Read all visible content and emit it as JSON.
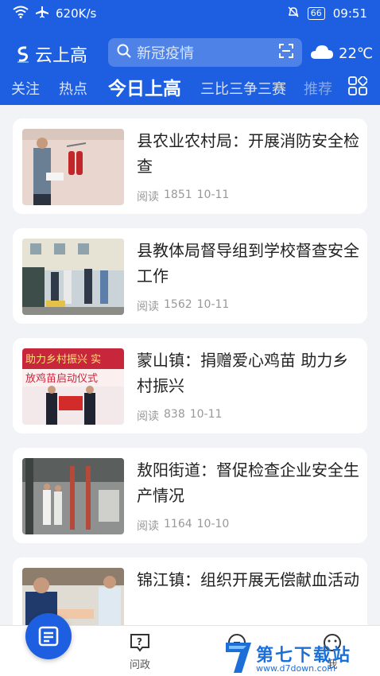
{
  "status_bar": {
    "network_speed": "620K/s",
    "battery": "66",
    "time": "09:51"
  },
  "header": {
    "app_name": "云上高",
    "search_placeholder": "新冠疫情",
    "temperature": "22℃",
    "accent_color": "#1d5fe0"
  },
  "tabs": [
    {
      "label": "关注"
    },
    {
      "label": "热点"
    },
    {
      "label": "今日上高",
      "active": true
    },
    {
      "label": "三比三争三赛"
    },
    {
      "label": "推荐"
    }
  ],
  "articles": [
    {
      "title": "县农业农村局：开展消防安全检查",
      "read_label": "阅读",
      "reads": "1851",
      "date": "10-11"
    },
    {
      "title": "县教体局督导组到学校督查安全工作",
      "read_label": "阅读",
      "reads": "1562",
      "date": "10-11"
    },
    {
      "title": "蒙山镇：捐赠爱心鸡苗 助力乡村振兴",
      "read_label": "阅读",
      "reads": "838",
      "date": "10-11"
    },
    {
      "title": "敖阳街道：督促检查企业安全生产情况",
      "read_label": "阅读",
      "reads": "1164",
      "date": "10-10"
    },
    {
      "title": "锦江镇：组织开展无偿献血活动",
      "read_label": "",
      "reads": "",
      "date": ""
    }
  ],
  "bottom_nav": [
    {
      "label": "",
      "icon": "news-icon"
    },
    {
      "label": "问政",
      "icon": "question-icon"
    },
    {
      "label": "",
      "icon": "discover-icon"
    },
    {
      "label": "我",
      "icon": "user-icon"
    }
  ],
  "image_text": {
    "article3_banner_top": "助力乡村振兴 实",
    "article3_banner_mid": "放鸡苗启动仪式"
  },
  "watermark": {
    "name": "第七下载站",
    "url": "www.d7down.com"
  }
}
